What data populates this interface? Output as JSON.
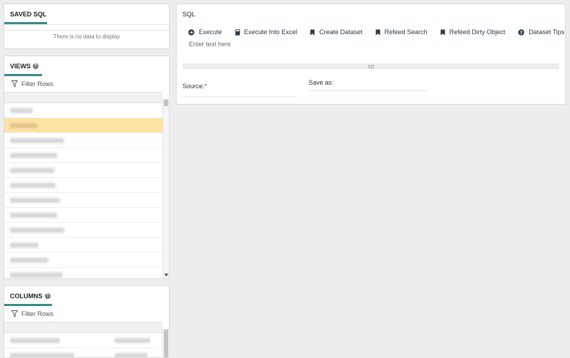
{
  "saved_sql": {
    "title": "SAVED SQL",
    "empty_text": "There is no data to display"
  },
  "views": {
    "title": "VIEWS",
    "filter_label": "Filter Rows",
    "selected_index": 1
  },
  "columns": {
    "title": "COLUMNS",
    "filter_label": "Filter Rows"
  },
  "sql": {
    "title": "SQL",
    "toolbar": {
      "execute": "Execute",
      "execute_excel": "Execute Into Excel",
      "create_dataset": "Create Dataset",
      "refeed_search": "Refeed Search",
      "refeed_dirty": "Refeed Dirty Object",
      "dataset_tips": "Dataset Tips"
    },
    "editor_placeholder": "Enter text here",
    "source_label": "Source:",
    "required_mark": "*",
    "save_as_label": "Save as:"
  },
  "colors": {
    "accent": "#3a8a8c",
    "selected_row": "#fde2a5",
    "required": "#d0312d",
    "toolbar_text": "#2c3a4b"
  }
}
